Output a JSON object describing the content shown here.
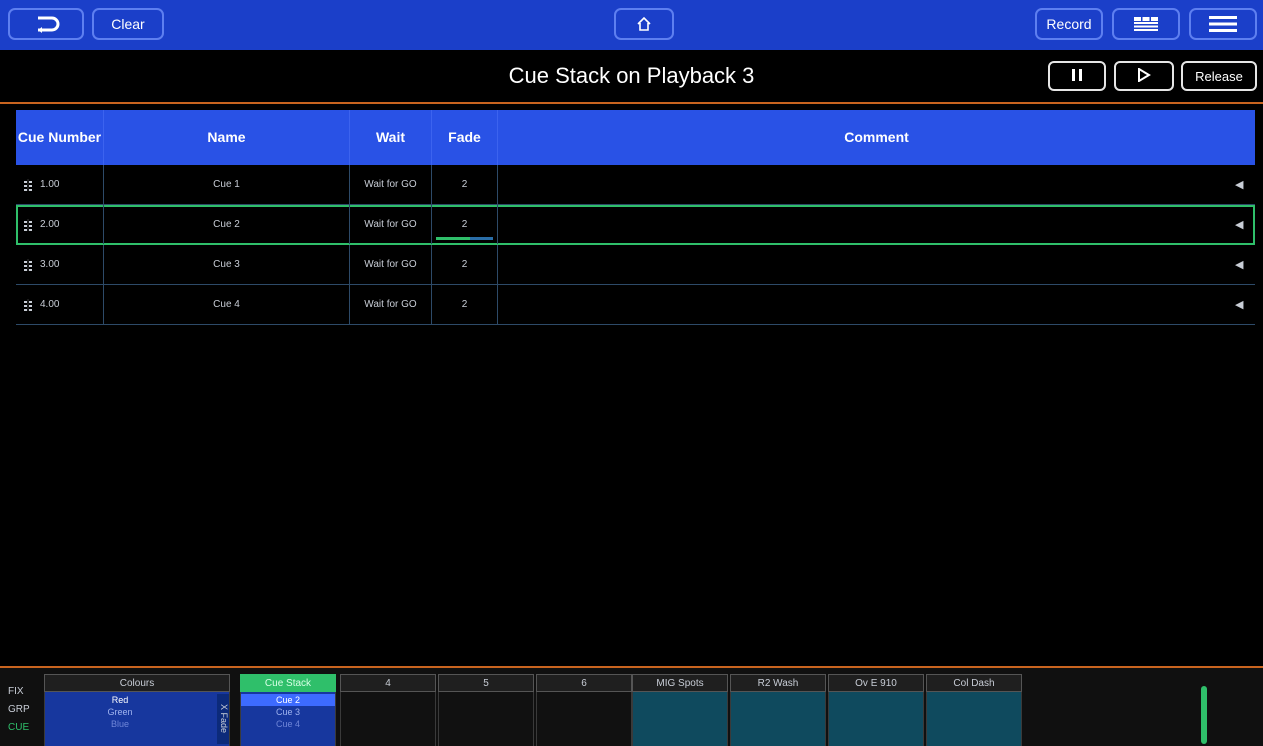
{
  "toolbar": {
    "back_icon": "back-arrow-icon",
    "clear_label": "Clear",
    "home_icon": "home-icon",
    "record_label": "Record",
    "view_icon": "layout-icon",
    "menu_icon": "hamburger-icon",
    "colors": {
      "bar": "#1b3fc9",
      "border": "#5e7ff0"
    }
  },
  "titlebar": {
    "title": "Cue Stack on Playback 3",
    "pause_icon": "pause-icon",
    "play_icon": "play-icon",
    "release_label": "Release"
  },
  "table": {
    "headers": {
      "cue_number": "Cue Number",
      "name": "Name",
      "wait": "Wait",
      "fade": "Fade",
      "comment": "Comment"
    },
    "rows": [
      {
        "cue_number": "1.00",
        "name": "Cue 1",
        "wait": "Wait for GO",
        "fade": "2",
        "comment": ""
      },
      {
        "cue_number": "2.00",
        "name": "Cue 2",
        "wait": "Wait for GO",
        "fade": "2",
        "comment": ""
      },
      {
        "cue_number": "3.00",
        "name": "Cue 3",
        "wait": "Wait for GO",
        "fade": "2",
        "comment": ""
      },
      {
        "cue_number": "4.00",
        "name": "Cue 4",
        "wait": "Wait for GO",
        "fade": "2",
        "comment": ""
      }
    ],
    "selected_row": 1,
    "fade_progress": 0.6,
    "colors": {
      "header": "#2952e6",
      "selected": "#2fbf6a"
    }
  },
  "bottom": {
    "side_labels": [
      "FIX",
      "GRP",
      "CUE"
    ],
    "playbacks": [
      {
        "label": "Colours",
        "items": [
          "Red",
          "Green",
          "Blue"
        ]
      },
      {
        "label": "Cue Stack",
        "items": [
          "Cue 2",
          "Cue 3",
          "Cue 4"
        ]
      },
      {
        "label": "4"
      },
      {
        "label": "5"
      },
      {
        "label": "6"
      },
      {
        "label": "MIG Spots"
      },
      {
        "label": "R2 Wash"
      },
      {
        "label": "Ov E 910"
      },
      {
        "label": "Col Dash"
      }
    ],
    "xfade_label": "X Fade",
    "colors": {
      "active": "#2fbf6a",
      "teal": "#0f4a5e"
    }
  }
}
